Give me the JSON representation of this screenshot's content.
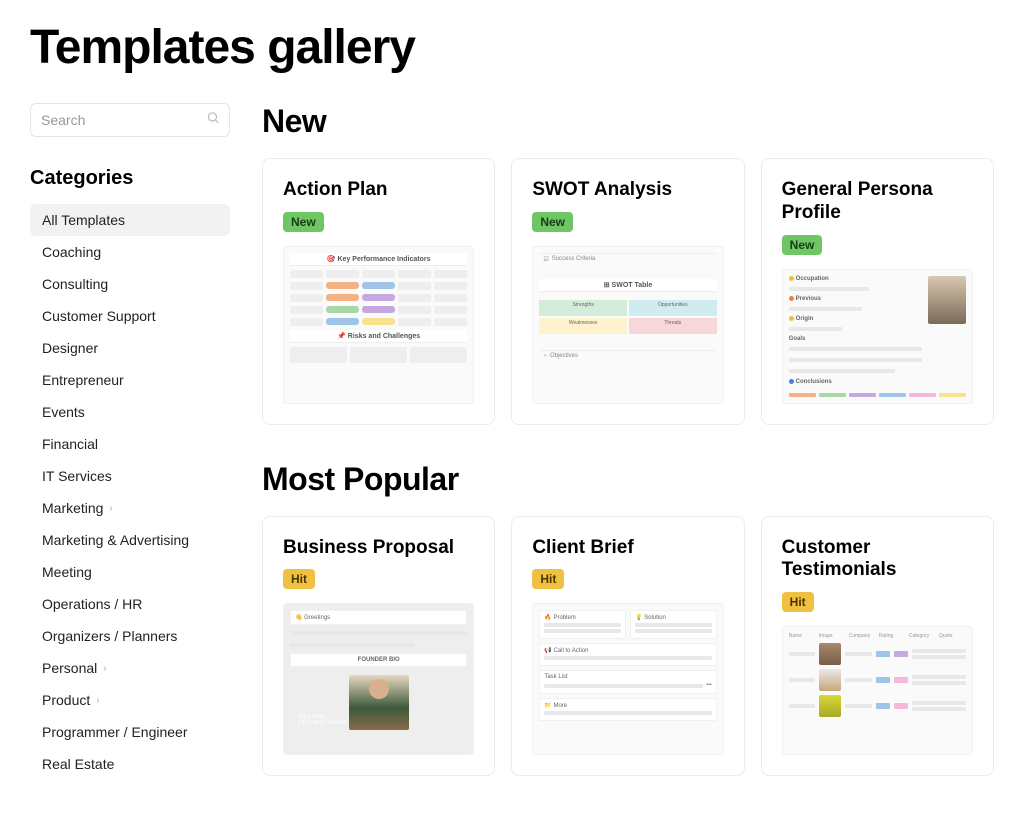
{
  "page_title": "Templates gallery",
  "search": {
    "placeholder": "Search"
  },
  "sidebar": {
    "heading": "Categories",
    "items": [
      {
        "label": "All Templates",
        "active": true,
        "expandable": false
      },
      {
        "label": "Coaching",
        "active": false,
        "expandable": false
      },
      {
        "label": "Consulting",
        "active": false,
        "expandable": false
      },
      {
        "label": "Customer Support",
        "active": false,
        "expandable": false
      },
      {
        "label": "Designer",
        "active": false,
        "expandable": false
      },
      {
        "label": "Entrepreneur",
        "active": false,
        "expandable": false
      },
      {
        "label": "Events",
        "active": false,
        "expandable": false
      },
      {
        "label": "Financial",
        "active": false,
        "expandable": false
      },
      {
        "label": "IT Services",
        "active": false,
        "expandable": false
      },
      {
        "label": "Marketing",
        "active": false,
        "expandable": true
      },
      {
        "label": "Marketing & Advertising",
        "active": false,
        "expandable": false
      },
      {
        "label": "Meeting",
        "active": false,
        "expandable": false
      },
      {
        "label": "Operations / HR",
        "active": false,
        "expandable": false
      },
      {
        "label": "Organizers / Planners",
        "active": false,
        "expandable": false
      },
      {
        "label": "Personal",
        "active": false,
        "expandable": true
      },
      {
        "label": "Product",
        "active": false,
        "expandable": true
      },
      {
        "label": "Programmer / Engineer",
        "active": false,
        "expandable": false
      },
      {
        "label": "Real Estate",
        "active": false,
        "expandable": false
      }
    ]
  },
  "sections": {
    "new": {
      "heading": "New",
      "cards": [
        {
          "title": "Action Plan",
          "badge": "New",
          "badge_type": "new",
          "preview": "action_plan"
        },
        {
          "title": "SWOT Analysis",
          "badge": "New",
          "badge_type": "new",
          "preview": "swot"
        },
        {
          "title": "General Persona Profile",
          "badge": "New",
          "badge_type": "new",
          "preview": "persona"
        }
      ]
    },
    "popular": {
      "heading": "Most Popular",
      "cards": [
        {
          "title": "Business Proposal",
          "badge": "Hit",
          "badge_type": "hit",
          "preview": "proposal"
        },
        {
          "title": "Client Brief",
          "badge": "Hit",
          "badge_type": "hit",
          "preview": "brief"
        },
        {
          "title": "Customer Testimonials",
          "badge": "Hit",
          "badge_type": "hit",
          "preview": "testimonials"
        }
      ]
    }
  },
  "previews": {
    "action_plan": {
      "title": "Key Performance Indicators",
      "sub": "Risks and Challenges"
    },
    "swot": {
      "success": "Success Criteria",
      "table": "SWOT Table",
      "cells": [
        "Strengths",
        "Opportunities",
        "Weaknesses",
        "Threats"
      ],
      "obj": "Objectives"
    },
    "persona": {
      "occupation": "Occupation",
      "previous": "Previous",
      "origin": "Origin",
      "goals": "Goals",
      "conclusions": "Conclusions"
    },
    "proposal": {
      "greetings": "Greetings",
      "name": "Paul Sher",
      "role": "CEO and Founder"
    },
    "brief": {
      "problem": "Problem",
      "solution": "Solution",
      "cta": "Call to Action",
      "tasklist": "Task List",
      "more": "More"
    },
    "testimonials": {
      "cols": [
        "Name",
        "Image",
        "Company",
        "Rating",
        "Category",
        "Quote"
      ]
    }
  }
}
